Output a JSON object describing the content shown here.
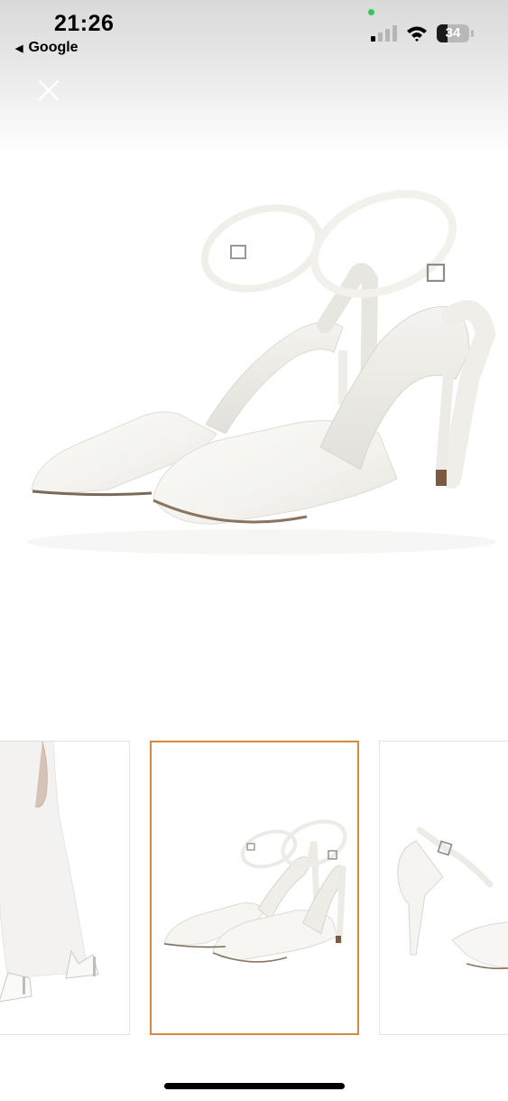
{
  "status_bar": {
    "time": "21:26",
    "back_label": "Google",
    "battery_percent": "34",
    "battery_level": 0.34,
    "signal_bars_active": 1
  },
  "gallery": {
    "close_icon": "close-icon",
    "main_image": "white satin pointed-toe ankle-strap stiletto pumps",
    "thumbnails": [
      {
        "subject": "model in white dress wearing heels",
        "selected": false
      },
      {
        "subject": "pair of white ankle-strap pumps",
        "selected": true
      },
      {
        "subject": "side view of single pump heel",
        "selected": false
      }
    ],
    "selected_border_color": "#d38a3c"
  }
}
